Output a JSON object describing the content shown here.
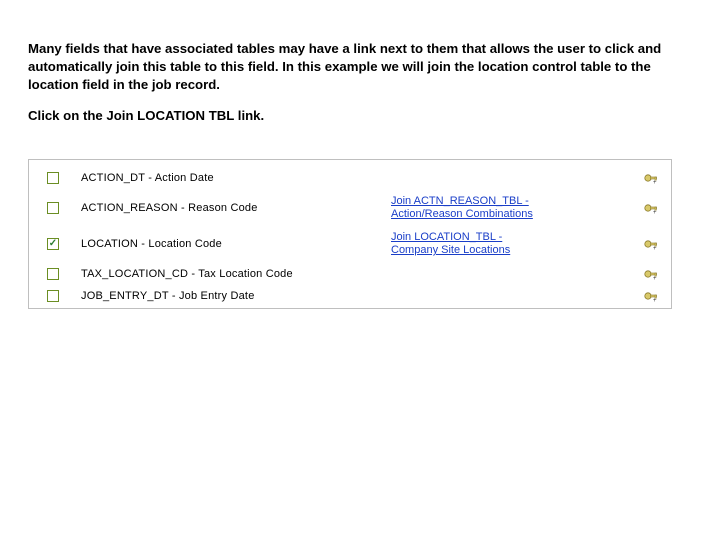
{
  "instructions": {
    "p1": "Many fields that have associated tables may have a link next to them that allows the user to click and automatically join this table to this field. In this example we will join the location control table to the location field in the job record.",
    "p2": "Click on the Join LOCATION TBL link."
  },
  "rows": [
    {
      "checked": false,
      "field": "ACTION_DT - Action Date",
      "link1": "",
      "link2": "",
      "has_key": true
    },
    {
      "checked": false,
      "field": "ACTION_REASON - Reason Code",
      "link1": "Join ACTN_REASON_TBL -",
      "link2": "Action/Reason Combinations",
      "has_key": true
    },
    {
      "checked": true,
      "field": "LOCATION - Location Code",
      "link1": "Join LOCATION_TBL -",
      "link2": "Company Site Locations",
      "has_key": true
    },
    {
      "checked": false,
      "field": "TAX_LOCATION_CD - Tax Location Code",
      "link1": "",
      "link2": "",
      "has_key": true
    },
    {
      "checked": false,
      "field": "JOB_ENTRY_DT - Job Entry Date",
      "link1": "",
      "link2": "",
      "has_key": true
    }
  ],
  "icons": {
    "checkmark": "✓"
  }
}
